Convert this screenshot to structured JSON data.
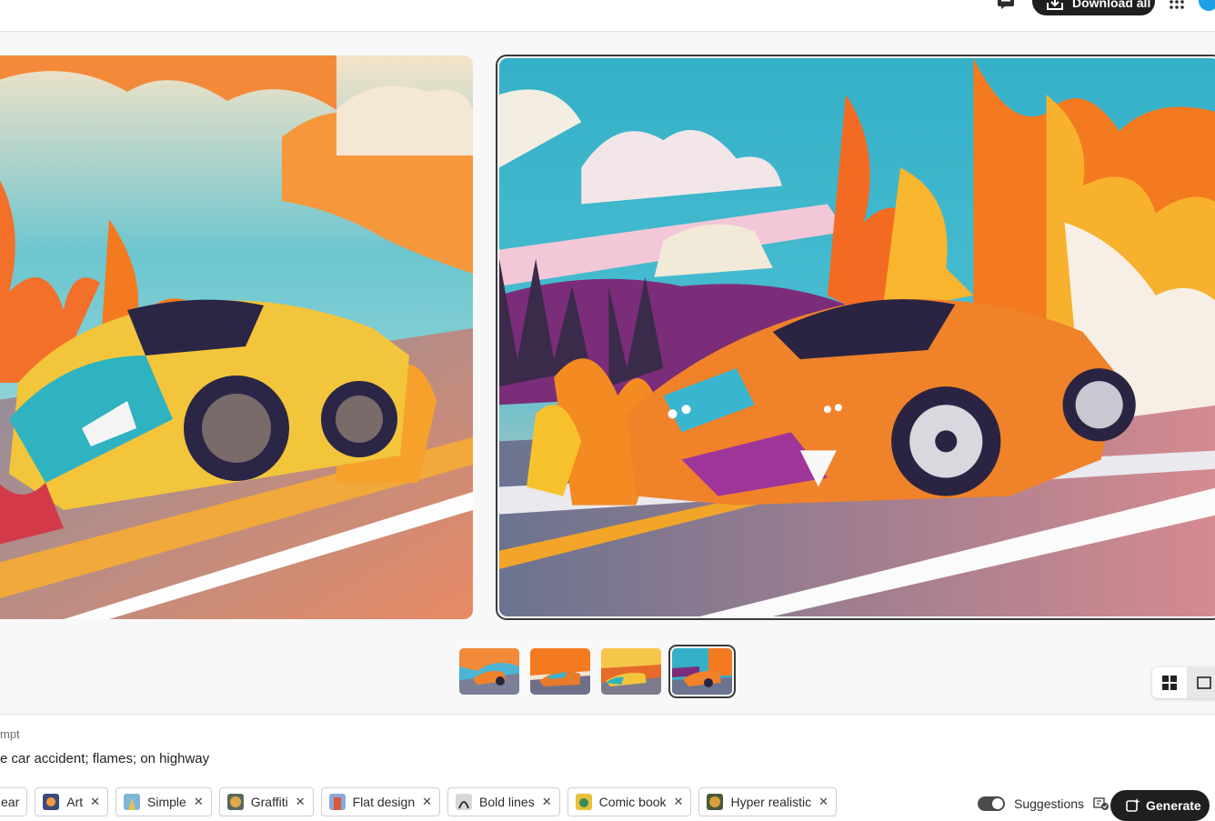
{
  "header": {
    "download_all_label": "Download all",
    "comment_icon": "comment-icon",
    "apps_icon": "apps-grid-icon",
    "avatar_color": "#1aa1e8"
  },
  "gallery": {
    "thumbnail_count": 4,
    "active_thumbnail": 4
  },
  "view_toggle": {
    "options": [
      "grid-view-icon",
      "single-view-icon"
    ],
    "selected": "single-view-icon"
  },
  "prompt": {
    "label": "mpt",
    "text": "e car accident; flames; on highway"
  },
  "style_chips": [
    {
      "label": "ear",
      "removable": false
    },
    {
      "label": "Art",
      "removable": true
    },
    {
      "label": "Simple",
      "removable": true
    },
    {
      "label": "Graffiti",
      "removable": true
    },
    {
      "label": "Flat design",
      "removable": true
    },
    {
      "label": "Bold lines",
      "removable": true
    },
    {
      "label": "Comic book",
      "removable": true
    },
    {
      "label": "Hyper realistic",
      "removable": true
    }
  ],
  "controls": {
    "suggestions_label": "Suggestions",
    "suggestions_on": true,
    "generate_label": "Generate"
  },
  "colors": {
    "sky": "#3fb6c9",
    "flame": "#f47a1f",
    "dark_button": "#1f1f1f"
  }
}
